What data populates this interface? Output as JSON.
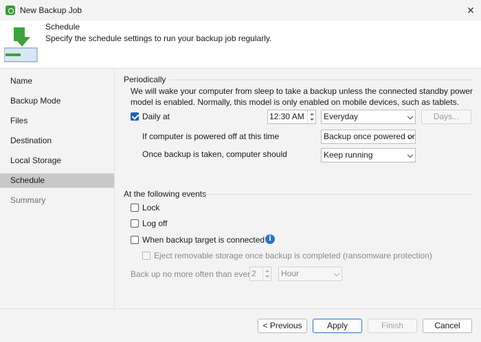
{
  "window": {
    "title": "New Backup Job"
  },
  "header": {
    "title": "Schedule",
    "description": "Specify the schedule settings to run your backup job regularly."
  },
  "sidebar": {
    "items": [
      {
        "label": "Name"
      },
      {
        "label": "Backup Mode"
      },
      {
        "label": "Files"
      },
      {
        "label": "Destination"
      },
      {
        "label": "Local Storage"
      },
      {
        "label": "Schedule"
      },
      {
        "label": "Summary"
      }
    ],
    "active_index": 5
  },
  "periodically": {
    "group_label": "Periodically",
    "note": "We will wake your computer from sleep to take a backup unless the connected standby power model is enabled. Normally, this model is only enabled on mobile devices, such as tablets.",
    "daily_at": {
      "label": "Daily at",
      "checked": true,
      "time": "12:30 AM",
      "frequency": "Everyday",
      "days_button": "Days..."
    },
    "powered_off": {
      "label": "If computer is powered off at this time",
      "value": "Backup once powered on"
    },
    "after_backup": {
      "label": "Once backup is taken, computer should",
      "value": "Keep running"
    }
  },
  "events": {
    "group_label": "At the following events",
    "lock": {
      "label": "Lock",
      "checked": false
    },
    "logoff": {
      "label": "Log off",
      "checked": false
    },
    "target_connected": {
      "label": "When backup target is connected",
      "checked": false
    },
    "eject": {
      "label": "Eject removable storage once backup is completed (ransomware protection)",
      "checked": false
    },
    "limit": {
      "label": "Back up no more often than every",
      "value": "2",
      "unit": "Hour"
    }
  },
  "footer": {
    "previous": "< Previous",
    "apply": "Apply",
    "finish": "Finish",
    "cancel": "Cancel"
  },
  "icons": {
    "header": "download-arrow-icon",
    "info": "info-icon",
    "app": "backup-app-icon"
  },
  "colors": {
    "accent": "#1f5fbf",
    "arrow": "#3aa43a",
    "active_item": "#c8c8c8"
  }
}
